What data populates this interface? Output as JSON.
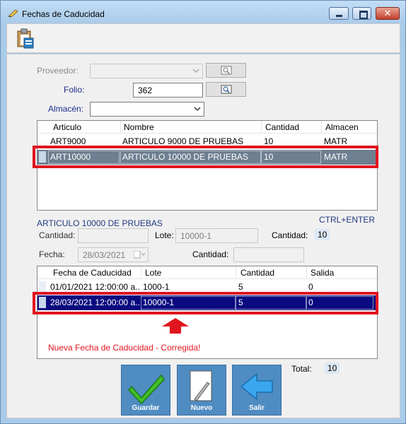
{
  "window": {
    "title": "Fechas de Caducidad"
  },
  "form": {
    "proveedor_label": "Proveedor:",
    "folio_label": "Folio:",
    "folio_value": "362",
    "almacen_label": "Almacén:"
  },
  "articles_grid": {
    "headers": [
      "Articulo",
      "Nombre",
      "Cantidad",
      "Almacen"
    ],
    "rows": [
      {
        "articulo": "ART9000",
        "nombre": "ARTICULO 9000 DE PRUEBAS",
        "cantidad": "10",
        "almacen": "MATR"
      },
      {
        "articulo": "ART10000",
        "nombre": "ARTICULO 10000 DE PRUEBAS",
        "cantidad": "10",
        "almacen": "MATR"
      }
    ],
    "selected_index": 1
  },
  "detail": {
    "article_name": "ARTICULO 10000 DE PRUEBAS",
    "shortcut": "CTRL+ENTER",
    "cantidad_label": "Cantidad:",
    "lote_label": "Lote:",
    "lote_placeholder": "10000-1",
    "cantidad_right_label": "Cantidad:",
    "cantidad_right_value": "10",
    "fecha_label": "Fecha:",
    "fecha_value": "28/03/2021",
    "cantidad2_label": "Cantidad:"
  },
  "expiry_grid": {
    "headers": [
      "Fecha de Caducidad",
      "Lote",
      "Cantidad",
      "Salida"
    ],
    "rows": [
      {
        "fecha": "01/01/2021 12:00:00 a...",
        "lote": "1000-1",
        "cantidad": "5",
        "salida": "0"
      },
      {
        "fecha": "28/03/2021 12:00:00 a...",
        "lote": "10000-1",
        "cantidad": "5",
        "salida": "0"
      }
    ],
    "selected_index": 1
  },
  "annotation": {
    "note": "Nueva Fecha de Caducidad - Corregida!",
    "color": "#e0151e"
  },
  "totals": {
    "label": "Total:",
    "value": "10"
  },
  "actions": {
    "guardar": "Guardar",
    "nuevo": "Nuevo",
    "salir": "Salir"
  },
  "icons": {
    "title": "pencil-icon",
    "toolbar": "clipboard-icon",
    "guardar": "checkmark-icon",
    "nuevo": "new-document-icon",
    "salir": "exit-arrow-icon"
  }
}
